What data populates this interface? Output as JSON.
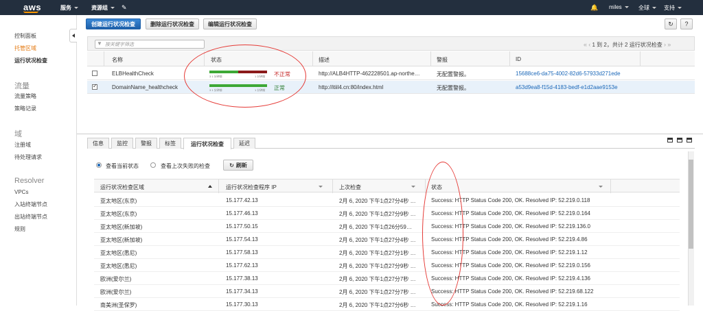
{
  "topbar": {
    "logo": "aws",
    "services": "服务",
    "resource_groups": "资源组",
    "user": "miles",
    "region": "全球",
    "support": "支持"
  },
  "sidebar": {
    "items": [
      {
        "label": "控制面板"
      },
      {
        "label": "托管区域"
      },
      {
        "label": "运行状况检查"
      }
    ],
    "traffic_heading": "流量",
    "traffic_items": [
      {
        "label": "流量策略"
      },
      {
        "label": "策略记录"
      }
    ],
    "domains_heading": "域",
    "domain_items": [
      {
        "label": "注册域"
      },
      {
        "label": "待处理请求"
      }
    ],
    "resolver_heading": "Resolver",
    "resolver_items": [
      {
        "label": "VPCs"
      },
      {
        "label": "入站终端节点"
      },
      {
        "label": "出站终端节点"
      },
      {
        "label": "规则"
      }
    ]
  },
  "toolbar": {
    "create": "创建运行状况检查",
    "delete": "删除运行状况检查",
    "edit": "编辑运行状况检查"
  },
  "filter": {
    "placeholder": "按关键字筛选",
    "pager": "1 到 2，共计 2 运行状况检查"
  },
  "healthchecks": {
    "headers": {
      "name": "名称",
      "status": "状态",
      "desc": "描述",
      "alarm": "警报",
      "id": "ID"
    },
    "bar_label_left": "3 1 分钟前",
    "bar_label_right": "1 分钟前",
    "rows": [
      {
        "name": "ELBHealthCheck",
        "status": "不正常",
        "status_color": "#c62828",
        "healthy_fraction": 0.5,
        "desc": "http://ALB4HTTP-462228501.ap-northe…",
        "alarm": "无配置警报。",
        "id": "15688ce6-da75-4002-82d6-57933d271ede",
        "checked": false
      },
      {
        "name": "DomainName_healthcheck",
        "status": "正常",
        "status_color": "#2e7d32",
        "healthy_fraction": 1.0,
        "desc": "http://itiil4.cn:80/index.html",
        "alarm": "无配置警报。",
        "id": "a53d9ea8-f15d-4183-bedf-e1d2aae9153e",
        "checked": true
      }
    ]
  },
  "tabs": [
    {
      "label": "信息"
    },
    {
      "label": "监控"
    },
    {
      "label": "警报"
    },
    {
      "label": "标签"
    },
    {
      "label": "运行状况检查"
    },
    {
      "label": "延迟"
    }
  ],
  "checker": {
    "radio_current": "查看当前状态",
    "radio_last_failure": "查看上次失败的检查",
    "refresh": "刷新",
    "headers": {
      "region": "运行状况检查区域",
      "ip": "运行状况检查程序 IP",
      "last": "上次检查",
      "status": "状态"
    },
    "rows": [
      {
        "region": "亚太地区(东京)",
        "ip": "15.177.42.13",
        "last": "2月 6, 2020 下午1点27分4秒 …",
        "status": "Success: HTTP Status Code 200, OK. Resolved IP: 52.219.0.118"
      },
      {
        "region": "亚太地区(东京)",
        "ip": "15.177.46.13",
        "last": "2月 6, 2020 下午1点27分9秒 …",
        "status": "Success: HTTP Status Code 200, OK. Resolved IP: 52.219.0.164"
      },
      {
        "region": "亚太地区(新加坡)",
        "ip": "15.177.50.15",
        "last": "2月 6, 2020 下午1点26分59…",
        "status": "Success: HTTP Status Code 200, OK. Resolved IP: 52.219.136.0"
      },
      {
        "region": "亚太地区(新加坡)",
        "ip": "15.177.54.13",
        "last": "2月 6, 2020 下午1点27分4秒 …",
        "status": "Success: HTTP Status Code 200, OK. Resolved IP: 52.219.4.86"
      },
      {
        "region": "亚太地区(悉尼)",
        "ip": "15.177.58.13",
        "last": "2月 6, 2020 下午1点27分1秒 …",
        "status": "Success: HTTP Status Code 200, OK. Resolved IP: 52.219.1.12"
      },
      {
        "region": "亚太地区(悉尼)",
        "ip": "15.177.62.13",
        "last": "2月 6, 2020 下午1点27分9秒 …",
        "status": "Success: HTTP Status Code 200, OK. Resolved IP: 52.219.0.156"
      },
      {
        "region": "欧洲(爱尔兰)",
        "ip": "15.177.38.13",
        "last": "2月 6, 2020 下午1点27分7秒 …",
        "status": "Success: HTTP Status Code 200, OK. Resolved IP: 52.219.4.136"
      },
      {
        "region": "欧洲(爱尔兰)",
        "ip": "15.177.34.13",
        "last": "2月 6, 2020 下午1点27分7秒 …",
        "status": "Success: HTTP Status Code 200, OK. Resolved IP: 52.219.68.122"
      },
      {
        "region": "南美洲(圣保罗)",
        "ip": "15.177.30.13",
        "last": "2月 6, 2020 下午1点27分6秒 …",
        "status": "Success: HTTP Status Code 200, OK. Resolved IP: 52.219.1.16"
      }
    ]
  }
}
